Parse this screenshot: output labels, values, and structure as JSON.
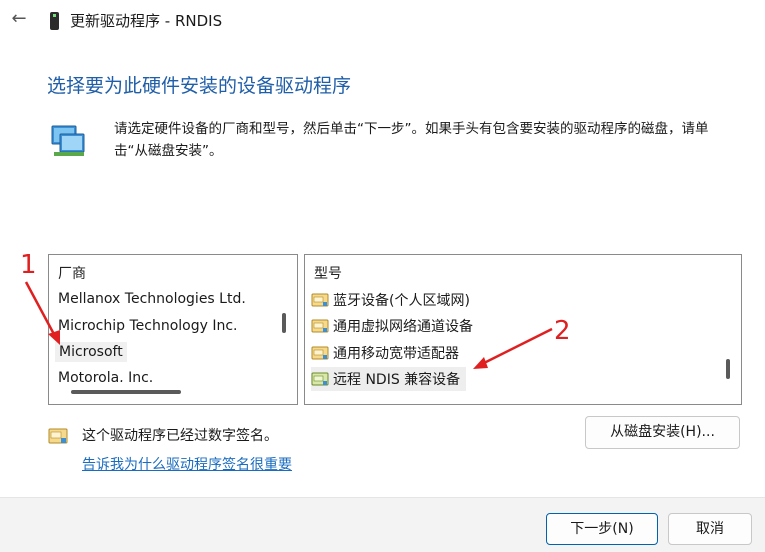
{
  "window": {
    "title": "更新驱动程序 - RNDIS",
    "back_label": "←"
  },
  "page": {
    "heading": "选择要为此硬件安装的设备驱动程序",
    "instruction": "请选定硬件设备的厂商和型号，然后单击“下一步”。如果手头有包含要安装的驱动程序的磁盘，请单击“从磁盘安装”。"
  },
  "manufacturers": {
    "header": "厂商",
    "items": [
      "Mellanox Technologies Ltd.",
      "Microchip Technology Inc.",
      "Microsoft",
      "Motorola, Inc."
    ],
    "selected": "Microsoft"
  },
  "models": {
    "header": "型号",
    "items": [
      "蓝牙设备(个人区域网)",
      "通用虚拟网络通道设备",
      "通用移动宽带适配器",
      "远程 NDIS 兼容设备"
    ],
    "selected": "远程 NDIS 兼容设备"
  },
  "signature": {
    "text": "这个驱动程序已经过数字签名。",
    "link": "告诉我为什么驱动程序签名很重要"
  },
  "buttons": {
    "have_disk": "从磁盘安装(H)...",
    "next": "下一步(N)",
    "cancel": "取消"
  },
  "annotations": {
    "label_1": "1",
    "label_2": "2",
    "color": "#e02020"
  },
  "colors": {
    "heading": "#1f5ea8",
    "link": "#1a6cc0",
    "accent_border": "#0063b1"
  },
  "icons": {
    "back": "back-arrow-icon",
    "device": "usb-device-icon",
    "network": "network-adapter-icon",
    "driver": "driver-package-icon",
    "certificate": "certificate-icon"
  }
}
